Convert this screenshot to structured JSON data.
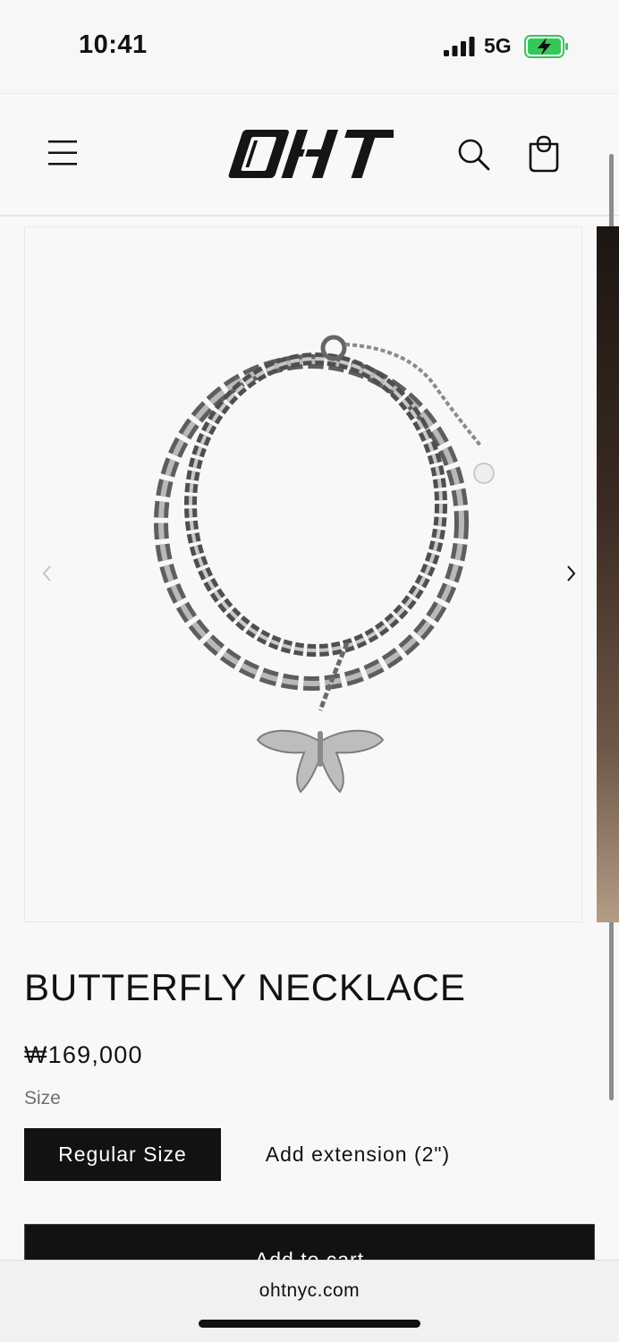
{
  "status_bar": {
    "time": "10:41",
    "network": "5G",
    "battery_state": "charging",
    "battery_color": "#35c759"
  },
  "header": {
    "logo_text": "OHT",
    "menu_icon": "hamburger-menu-icon",
    "search_icon": "search-icon",
    "cart_icon": "shopping-bag-icon"
  },
  "gallery": {
    "image_alt": "butterfly necklace",
    "prev_icon": "chevron-left-icon",
    "next_icon": "chevron-right-icon"
  },
  "product": {
    "title": "BUTTERFLY NECKLACE",
    "price": "₩169,000",
    "size_label": "Size",
    "size_options": [
      {
        "label": "Regular Size",
        "selected": true
      },
      {
        "label": "Add extension (2\")",
        "selected": false
      }
    ],
    "add_to_cart_label": "Add to cart"
  },
  "browser": {
    "url": "ohtnyc.com",
    "load_progress": 0.4,
    "accent_color": "#2f7cf6"
  }
}
